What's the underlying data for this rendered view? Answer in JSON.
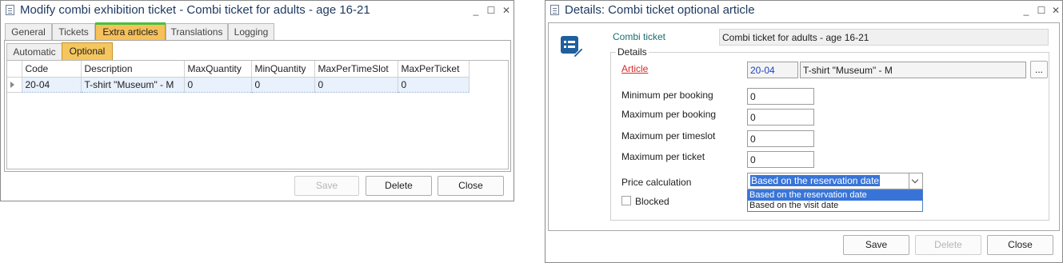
{
  "left_window": {
    "title": "Modify combi exhibition ticket  - Combi ticket for adults - age 16-21",
    "controls": {
      "minimize": "_",
      "maximize": "☐",
      "close": "✕"
    },
    "tabs": [
      "General",
      "Tickets",
      "Extra articles",
      "Translations",
      "Logging"
    ],
    "active_tab": "Extra articles",
    "sub_tabs": [
      "Automatic",
      "Optional"
    ],
    "active_sub_tab": "Optional",
    "grid": {
      "columns": [
        "Code",
        "Description",
        "MaxQuantity",
        "MinQuantity",
        "MaxPerTimeSlot",
        "MaxPerTicket"
      ],
      "rows": [
        [
          "20-04",
          "T-shirt \"Museum\" - M",
          "0",
          "0",
          "0",
          "0"
        ]
      ]
    },
    "buttons": {
      "save": "Save",
      "delete": "Delete",
      "close": "Close"
    }
  },
  "right_window": {
    "title": "Details: Combi ticket optional article",
    "controls": {
      "minimize": "_",
      "maximize": "☐",
      "close": "✕"
    },
    "icon": "list-edit-icon",
    "combi_ticket_label": "Combi ticket",
    "combi_ticket_value": "Combi ticket for adults - age 16-21",
    "details_group": "Details",
    "article_label": "Article",
    "article_code": "20-04",
    "article_desc": "T-shirt \"Museum\" - M",
    "article_browse": "...",
    "min_per_booking_label": "Minimum per booking",
    "min_per_booking": "0",
    "max_per_booking_label": "Maximum per booking",
    "max_per_booking": "0",
    "max_per_timeslot_label": "Maximum per timeslot",
    "max_per_timeslot": "0",
    "max_per_ticket_label": "Maximum per ticket",
    "max_per_ticket": "0",
    "price_calc_label": "Price calculation",
    "price_calc_value": "Based on the reservation date",
    "price_calc_options": [
      "Based on the reservation date",
      "Based on the visit date"
    ],
    "blocked_label": "Blocked",
    "buttons": {
      "save": "Save",
      "delete": "Delete",
      "close": "Close"
    }
  },
  "colors": {
    "active_tab": "#f7c15a",
    "tab_accent": "#4bbf3c",
    "title_text": "#1f3a62",
    "required_label": "#d52b2b",
    "selection": "#3874d8"
  }
}
